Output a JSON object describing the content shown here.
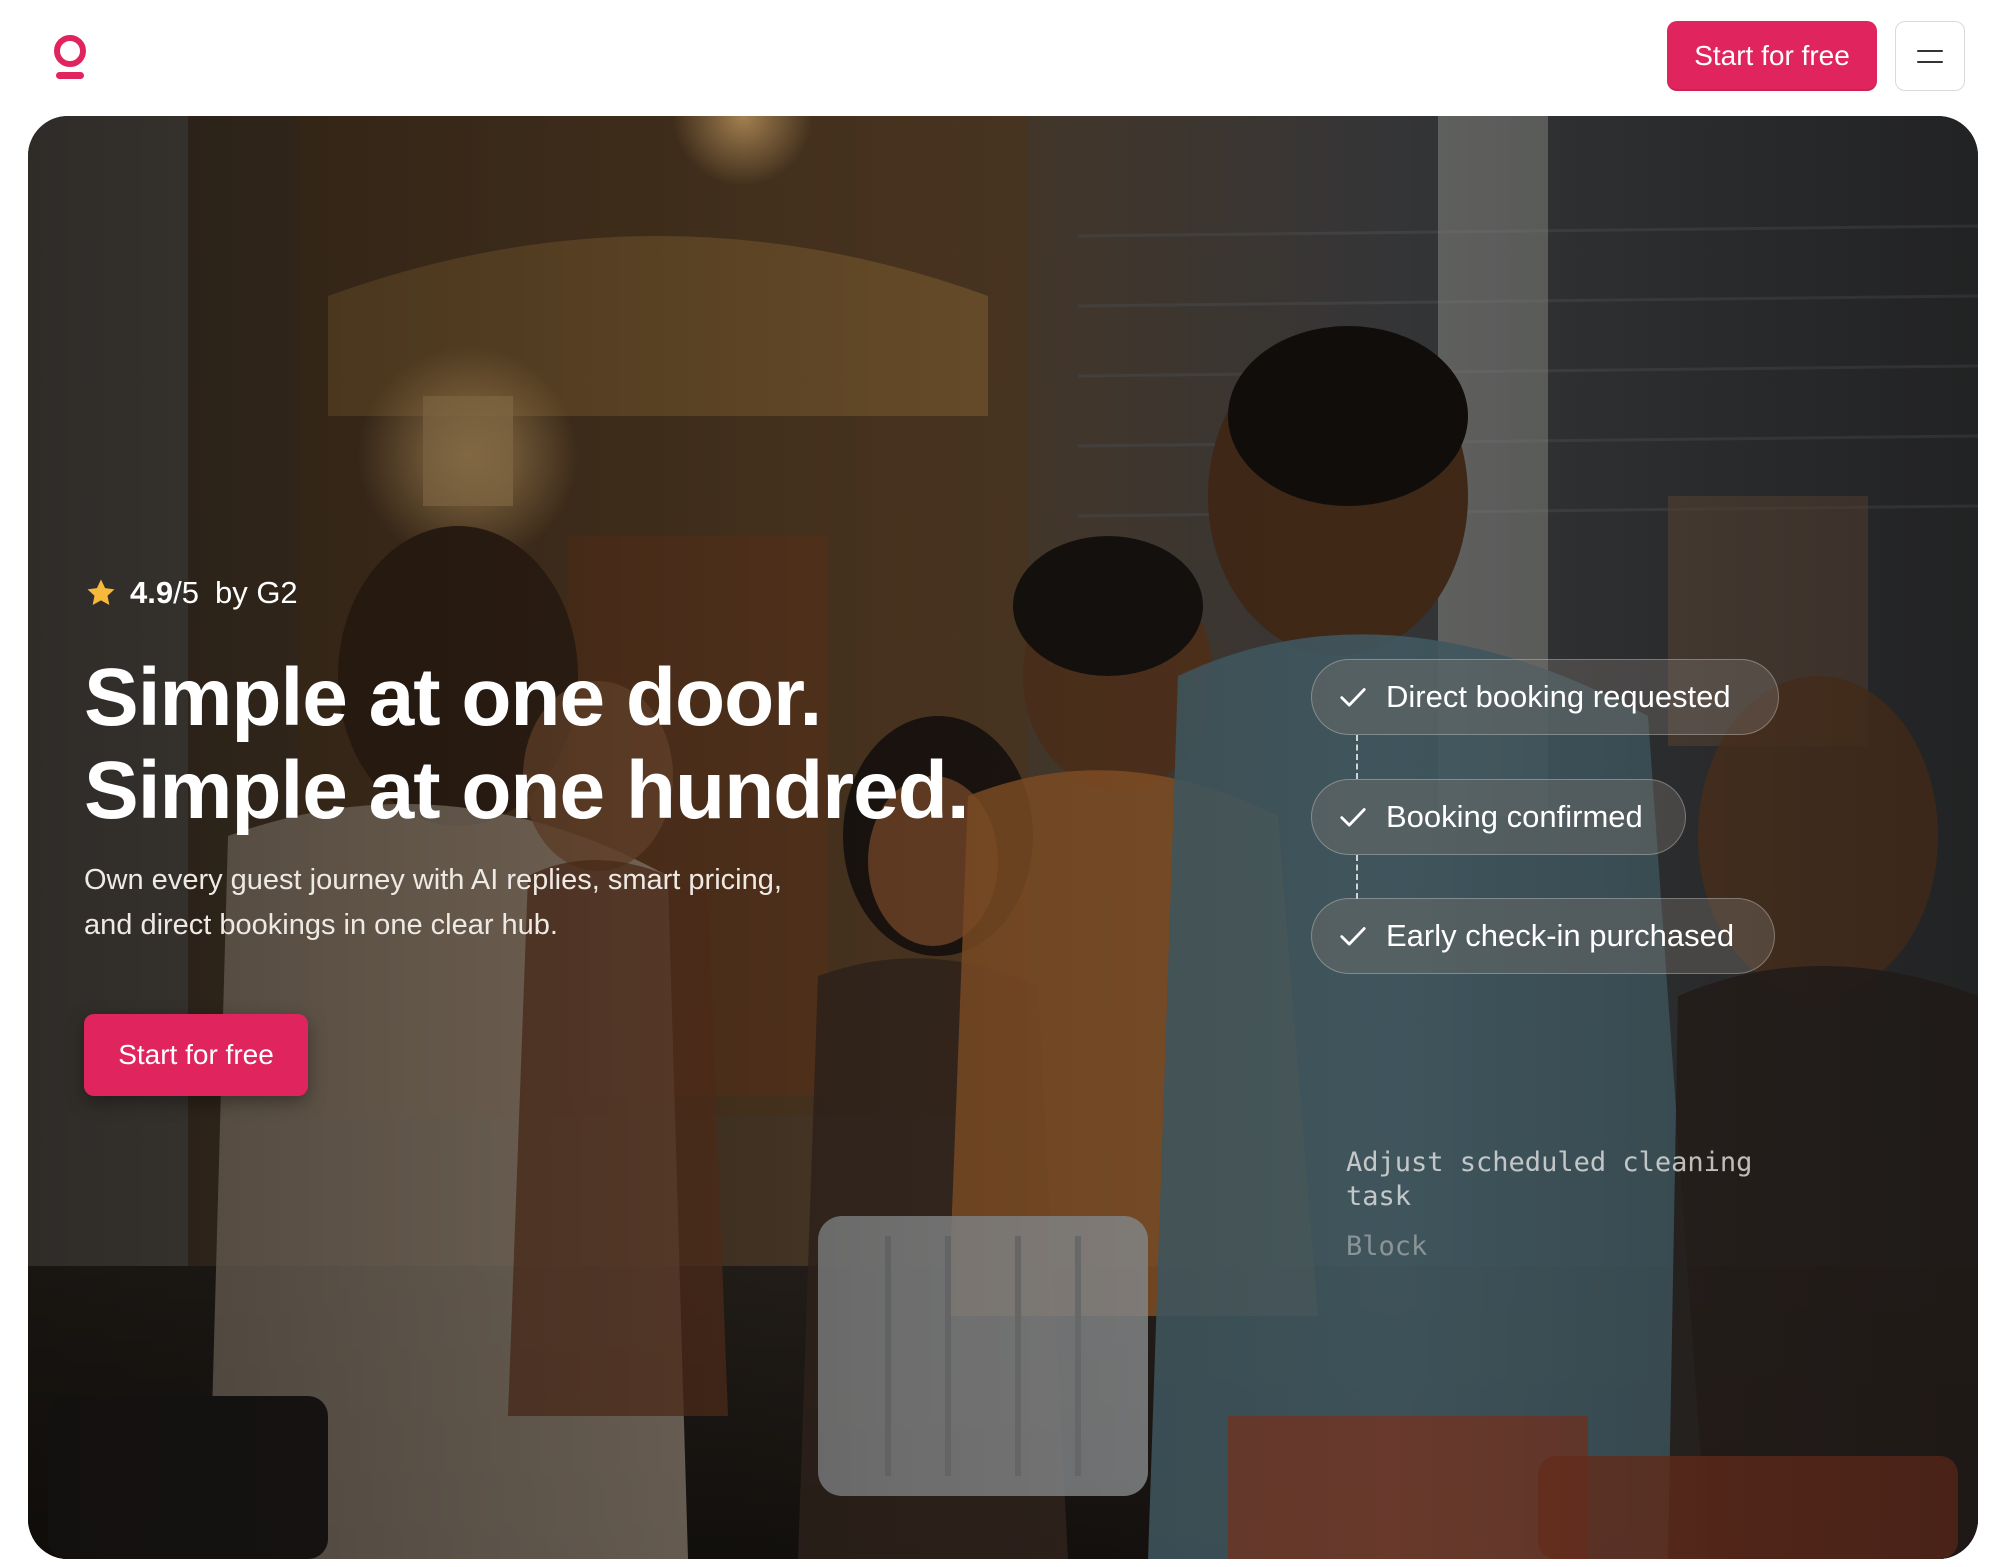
{
  "header": {
    "logo_icon": "location-pin-logo-icon",
    "cta_label": "Start for free",
    "menu_icon": "hamburger-menu-icon"
  },
  "hero": {
    "rating": {
      "star_icon": "star-icon",
      "score": "4.9",
      "scale": "/5",
      "source": "by G2"
    },
    "headline_line1": "Simple at one door.",
    "headline_line2": "Simple at one hundred.",
    "subcopy": "Own every guest journey with AI replies, smart pricing, and direct bookings in one clear hub.",
    "cta_label": "Start for free",
    "activity": [
      {
        "label": "Direct booking requested",
        "icon": "check-icon"
      },
      {
        "label": "Booking confirmed",
        "icon": "check-icon"
      },
      {
        "label": "Early check-in purchased",
        "icon": "check-icon"
      }
    ],
    "automation": {
      "task": "Adjust scheduled cleaning task",
      "tag": "Block"
    }
  },
  "colors": {
    "brand": "#e0245e",
    "star": "#f6b93b"
  }
}
